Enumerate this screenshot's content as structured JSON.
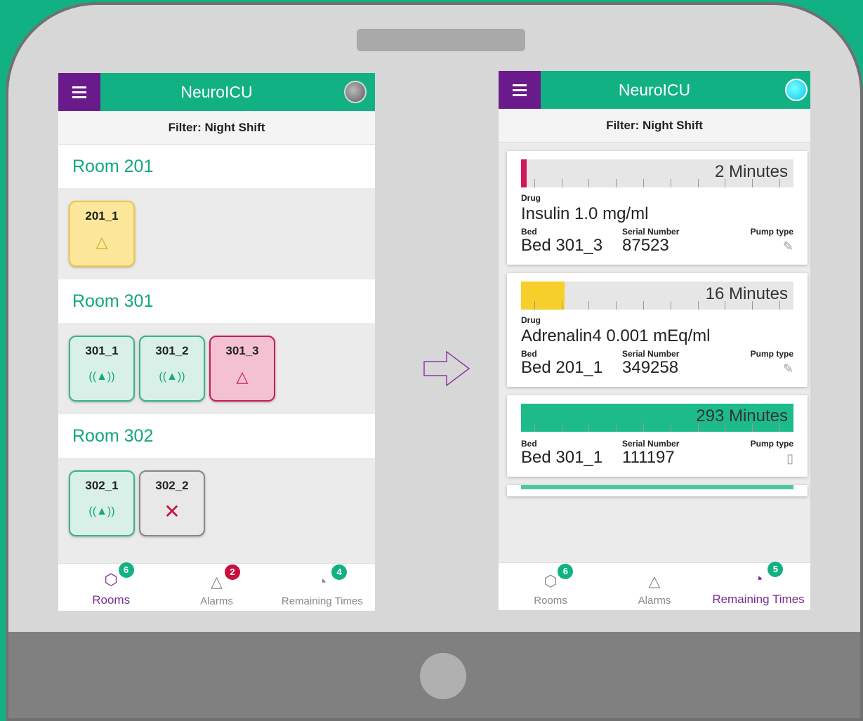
{
  "left_screen": {
    "header": {
      "title": "NeuroICU",
      "menu_icon": "hamburger-icon",
      "status": "disconnected"
    },
    "filter": "Filter: Night Shift",
    "rooms": [
      {
        "name": "Room 201",
        "beds": [
          {
            "label": "201_1",
            "state": "warning",
            "icon": "warning-triangle-icon"
          }
        ]
      },
      {
        "name": "Room 301",
        "beds": [
          {
            "label": "301_1",
            "state": "ok",
            "icon": "signal-icon"
          },
          {
            "label": "301_2",
            "state": "ok",
            "icon": "signal-icon"
          },
          {
            "label": "301_3",
            "state": "alarm",
            "icon": "alarm-triangle-icon"
          }
        ]
      },
      {
        "name": "Room 302",
        "beds": [
          {
            "label": "302_1",
            "state": "ok",
            "icon": "signal-icon"
          },
          {
            "label": "302_2",
            "state": "offline",
            "icon": "close-icon"
          }
        ]
      }
    ],
    "nav": [
      {
        "label": "Rooms",
        "icon": "cube-icon",
        "badge": "6",
        "active": true
      },
      {
        "label": "Alarms",
        "icon": "triangle-icon",
        "badge": "2",
        "active": false
      },
      {
        "label": "Remaining Times",
        "icon": "timer-icon",
        "badge": "4",
        "active": false
      }
    ]
  },
  "right_screen": {
    "header": {
      "title": "NeuroICU",
      "menu_icon": "hamburger-icon",
      "status": "connected"
    },
    "filter": "Filter: Night Shift",
    "cards": [
      {
        "remaining": "2 Minutes",
        "fraction": 0.02,
        "color": "#d3155a",
        "drug_label": "Drug",
        "drug": "Insulin 1.0 mg/ml",
        "bed_label": "Bed",
        "bed": "Bed 301_3",
        "serial_label": "Serial Number",
        "serial": "87523",
        "pump_label": "Pump type",
        "pump_icon": "syringe-icon"
      },
      {
        "remaining": "16 Minutes",
        "fraction": 0.16,
        "color": "#f6cf2b",
        "drug_label": "Drug",
        "drug": "Adrenalin4 0.001 mEq/ml",
        "bed_label": "Bed",
        "bed": "Bed 201_1",
        "serial_label": "Serial Number",
        "serial": "349258",
        "pump_label": "Pump type",
        "pump_icon": "syringe-icon"
      },
      {
        "remaining": "293 Minutes",
        "fraction": 1.0,
        "color": "#1dbb8a",
        "bed_label": "Bed",
        "bed": "Bed 301_1",
        "serial_label": "Serial Number",
        "serial": "111197",
        "pump_label": "Pump type",
        "pump_icon": "infusion-pump-icon"
      }
    ],
    "nav": [
      {
        "label": "Rooms",
        "icon": "cube-icon",
        "badge": "6",
        "active": false
      },
      {
        "label": "Alarms",
        "icon": "triangle-icon",
        "badge": "",
        "active": false
      },
      {
        "label": "Remaining Times",
        "icon": "timer-icon",
        "badge": "5",
        "active": true
      }
    ]
  },
  "colors": {
    "brand_green": "#12b184",
    "menu_purple": "#6a1a8b",
    "alarm_red": "#c81e55",
    "warn_yellow": "#fde79a",
    "active_tab": "#7b2b93"
  }
}
